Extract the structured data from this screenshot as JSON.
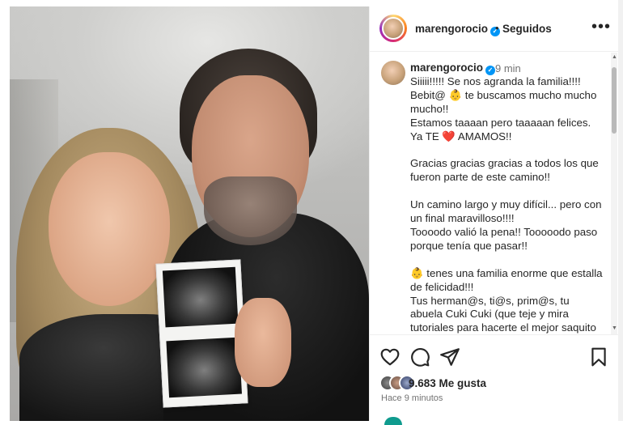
{
  "post": {
    "username": "marengorocio",
    "follow_status": "Seguidos",
    "separator": "•",
    "more_label": "•••"
  },
  "caption": {
    "username": "marengorocio",
    "time": "9 min",
    "text": "Siiiii!!!!! Se nos agranda la familia!!!!\nBebit@ 👶 te buscamos mucho mucho mucho!!\nEstamos taaaan pero taaaaan felices.\nYa TE ❤️ AMAMOS!!\n\nGracias gracias gracias a todos los que fueron parte de este camino!!\n\nUn camino largo y muy difícil... pero con un final maravilloso!!!!\nToooodo valió la pena!! Tooooodo paso porque tenía que pasar!!\n\n👶 tenes una familia enorme que estalla de felicidad!!!\nTus herman@s, ti@s, prim@s, tu abuela Cuki Cuki (que teje y mira tutoriales para hacerte el mejor saquito 🥰) y los"
  },
  "engagement": {
    "likes": "9.683 Me gusta",
    "time_ago": "Hace 9 minutos"
  },
  "icons": {
    "like": "heart-icon",
    "comment": "comment-icon",
    "share": "share-icon",
    "save": "bookmark-icon",
    "verified": "verified-badge-icon",
    "more": "more-options-icon"
  },
  "colors": {
    "verified": "#0095f6",
    "secondary_text": "#737373",
    "border": "#efefef"
  }
}
